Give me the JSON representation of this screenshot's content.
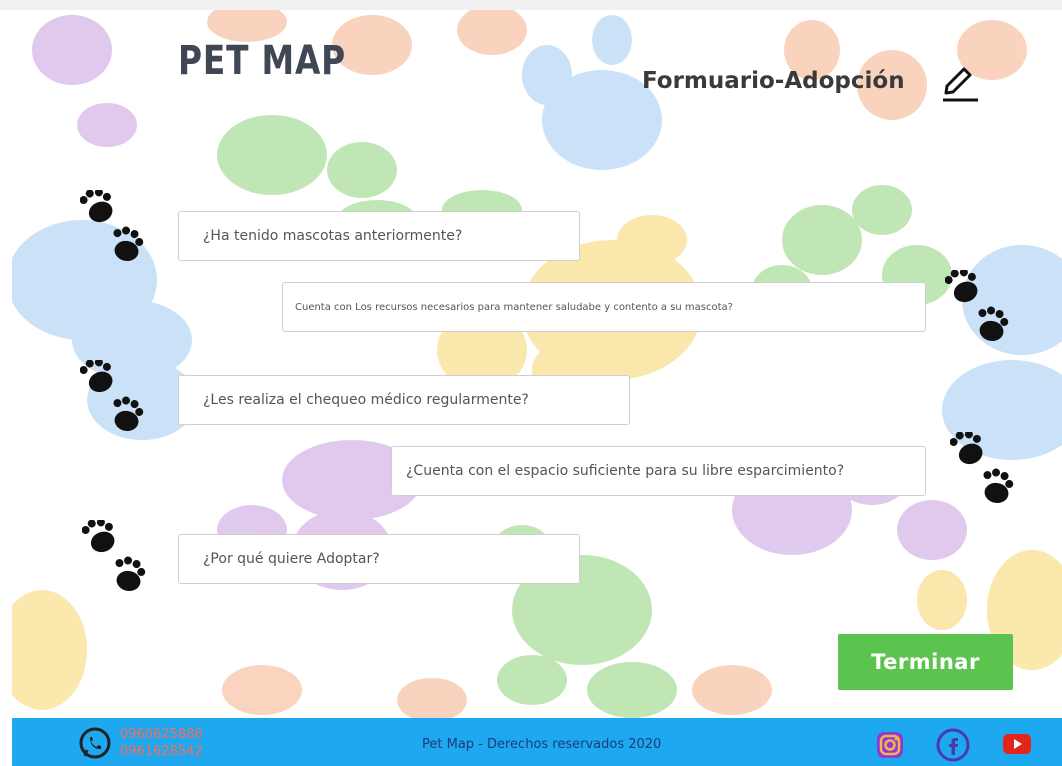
{
  "brand": {
    "name": "PET MAP"
  },
  "form": {
    "title": "Formuario-Adopción",
    "fields": [
      {
        "placeholder": "¿Ha tenido mascotas anteriormente?"
      },
      {
        "placeholder": "Cuenta con Los recursos necesarios para mantener saludabe y contento a su mascota?"
      },
      {
        "placeholder": "¿Les realiza el chequeo médico regularmente?"
      },
      {
        "placeholder": "¿Cuenta con el espacio suficiente para su libre esparcimiento?"
      },
      {
        "placeholder": "¿Por qué quiere Adoptar?"
      }
    ],
    "submit_label": "Terminar"
  },
  "footer": {
    "phones": [
      "0960625886",
      "0961628542"
    ],
    "copyright": "Pet Map - Derechos reservados 2020",
    "social": [
      "instagram-icon",
      "facebook-icon",
      "youtube-icon"
    ]
  },
  "colors": {
    "footer": "#1ea8ef",
    "button": "#5bc44f",
    "phone_text": "#ff6a55",
    "brand_text": "#3f4654"
  },
  "icons": {
    "edit": "pencil-icon",
    "decor": "paw-icon",
    "whatsapp": "whatsapp-icon"
  }
}
